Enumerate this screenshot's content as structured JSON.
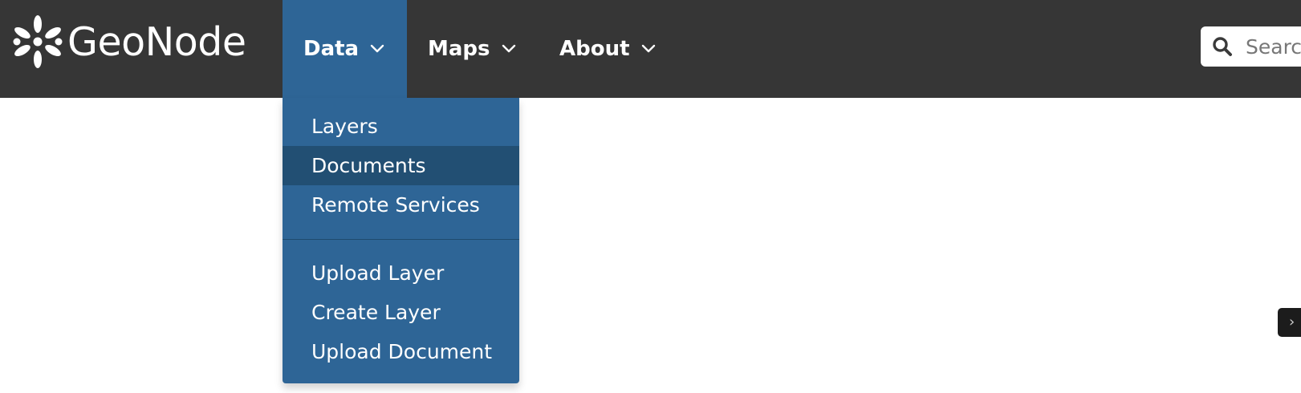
{
  "navbar": {
    "brand_text": "GeoNode",
    "menus": [
      {
        "label": "Data",
        "icon": "chevron-down-icon",
        "open": true
      },
      {
        "label": "Maps",
        "icon": "chevron-down-icon"
      },
      {
        "label": "About",
        "icon": "chevron-down-icon"
      }
    ],
    "search": {
      "placeholder": "Search",
      "value": ""
    },
    "colors": {
      "bar": "#363636",
      "active_menu": "#2e6596"
    }
  },
  "data_menu": {
    "items": [
      {
        "label": "Layers"
      },
      {
        "label": "Documents",
        "hovered": true
      },
      {
        "label": "Remote Services"
      }
    ],
    "upload_items": [
      {
        "label": "Upload Layer"
      },
      {
        "label": "Create Layer"
      },
      {
        "label": "Upload Document"
      }
    ],
    "colors": {
      "background": "#2e6596",
      "hover": "#224f73"
    }
  },
  "side_tab": {
    "glyph": "›",
    "icon": "chevron-right-icon"
  }
}
